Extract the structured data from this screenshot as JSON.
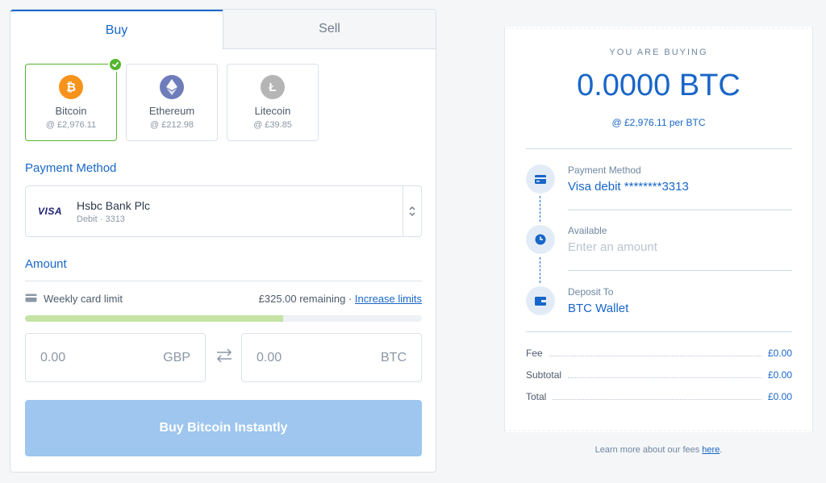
{
  "tabs": [
    {
      "label": "Buy",
      "active": true
    },
    {
      "label": "Sell",
      "active": false
    }
  ],
  "coins": [
    {
      "name": "Bitcoin",
      "price": "@ £2,976.11",
      "symbol": "₿",
      "color": "#f7931a",
      "icon": "bitcoin-icon",
      "selected": true
    },
    {
      "name": "Ethereum",
      "price": "@ £212.98",
      "symbol": "◆",
      "color": "#6f7cba",
      "icon": "ethereum-icon",
      "selected": false
    },
    {
      "name": "Litecoin",
      "price": "@ £39.85",
      "symbol": "Ł",
      "color": "#b5b5b5",
      "icon": "litecoin-icon",
      "selected": false
    }
  ],
  "payment": {
    "title": "Payment Method",
    "logo": "VISA",
    "bank": "Hsbc Bank Plc",
    "sub": "Debit · 3313"
  },
  "amount": {
    "title": "Amount",
    "limit_label": "Weekly card limit",
    "remaining": "£325.00 remaining",
    "separator": "·",
    "increase_link": "Increase limits",
    "limit_fraction": 0.65,
    "fiat_value": "0.00",
    "fiat_currency": "GBP",
    "crypto_value": "0.00",
    "crypto_currency": "BTC"
  },
  "buy_button": "Buy Bitcoin Instantly",
  "receipt": {
    "heading": "YOU ARE BUYING",
    "amount": "0.0000 BTC",
    "rate": "@ £2,976.11 per BTC",
    "steps": [
      {
        "label": "Payment Method",
        "value": "Visa debit ********3313",
        "icon": "credit-card-icon",
        "placeholder": false
      },
      {
        "label": "Available",
        "value": "Enter an amount",
        "icon": "clock-icon",
        "placeholder": true
      },
      {
        "label": "Deposit To",
        "value": "BTC Wallet",
        "icon": "wallet-icon",
        "placeholder": false
      }
    ],
    "fees": [
      {
        "label": "Fee",
        "value": "£0.00"
      },
      {
        "label": "Subtotal",
        "value": "£0.00"
      },
      {
        "label": "Total",
        "value": "£0.00"
      }
    ]
  },
  "learn_more": {
    "text": "Learn more about our fees ",
    "link": "here",
    "suffix": "."
  },
  "colors": {
    "accent": "#1866c9",
    "success": "#53b62d",
    "button_disabled": "#9ec6ee"
  }
}
